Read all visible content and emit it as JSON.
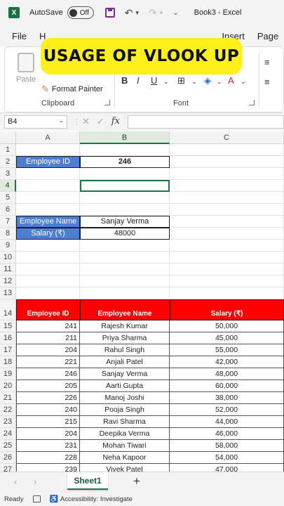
{
  "titlebar": {
    "app_logo": "X",
    "autosave_label": "AutoSave",
    "autosave_state": "Off",
    "doc_title": "Book3 - Excel"
  },
  "tabs": [
    "File",
    "H",
    "Insert",
    "Page"
  ],
  "ribbon": {
    "paste_label": "Paste",
    "format_painter_label": "Format Painter",
    "clipboard_label": "Clipboard",
    "font_label": "Font"
  },
  "banner": {
    "text": "USAGE OF VLOOK UP"
  },
  "formula_bar": {
    "name_box": "B4",
    "formula": ""
  },
  "columns": [
    "A",
    "B",
    "C"
  ],
  "selected_column": "B",
  "selected_row": "4",
  "lookup": {
    "id_label": "Employee ID",
    "id_value": "246",
    "name_label": "Employee Name",
    "name_value": "Sanjay Verma",
    "salary_label": "Salary (₹)",
    "salary_value": "48000"
  },
  "empty_rows_top": [
    "1",
    "3",
    "5",
    "6",
    "9",
    "10",
    "11",
    "12",
    "13"
  ],
  "table": {
    "header_row": "14",
    "headers": [
      "Employee ID",
      "Employee Name",
      "Salary (₹)"
    ],
    "rows": [
      {
        "row": "15",
        "id": "241",
        "name": "Rajesh Kumar",
        "salary": "50,000"
      },
      {
        "row": "16",
        "id": "211",
        "name": "Priya Sharma",
        "salary": "45,000"
      },
      {
        "row": "17",
        "id": "204",
        "name": "Rahul Singh",
        "salary": "55,000"
      },
      {
        "row": "18",
        "id": "221",
        "name": "Anjali Patel",
        "salary": "42,000"
      },
      {
        "row": "19",
        "id": "246",
        "name": "Sanjay Verma",
        "salary": "48,000"
      },
      {
        "row": "20",
        "id": "205",
        "name": "Aarti Gupta",
        "salary": "60,000"
      },
      {
        "row": "21",
        "id": "226",
        "name": "Manoj Joshi",
        "salary": "38,000"
      },
      {
        "row": "22",
        "id": "240",
        "name": "Pooja Singh",
        "salary": "52,000"
      },
      {
        "row": "23",
        "id": "215",
        "name": "Ravi Sharma",
        "salary": "44,000"
      },
      {
        "row": "24",
        "id": "204",
        "name": "Deepika Verma",
        "salary": "46,000"
      },
      {
        "row": "25",
        "id": "231",
        "name": "Mohan Tiwari",
        "salary": "58,000"
      },
      {
        "row": "26",
        "id": "228",
        "name": "Neha Kapoor",
        "salary": "54,000"
      },
      {
        "row": "27",
        "id": "239",
        "name": "Vivek Patel",
        "salary": "47,000"
      }
    ]
  },
  "sheet_tab": "Sheet1",
  "status": {
    "ready": "Ready",
    "accessibility": "Accessibility: Investigate"
  },
  "colors": {
    "label_blue": "#4e7ed1",
    "header_red": "#ff0000",
    "banner_yellow": "#ffef1a",
    "excel_green": "#217346"
  }
}
